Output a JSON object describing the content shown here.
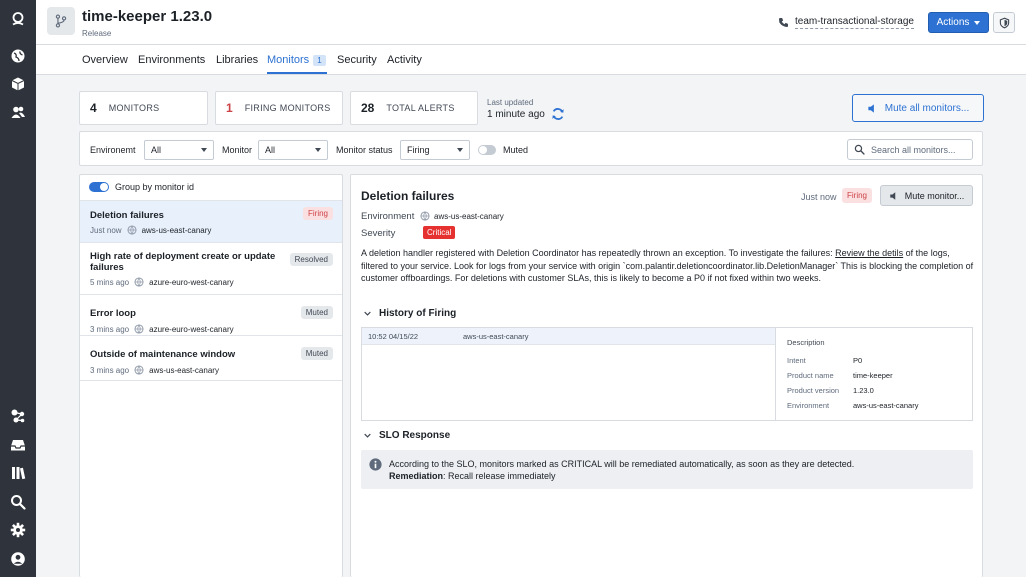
{
  "app": {
    "title": "time-keeper 1.23.0",
    "subtitle": "Release",
    "team": "team-transactional-storage",
    "actions_label": "Actions"
  },
  "tabs": [
    {
      "label": "Overview",
      "active": false
    },
    {
      "label": "Environments",
      "active": false
    },
    {
      "label": "Libraries",
      "active": false
    },
    {
      "label": "Monitors",
      "count": "1",
      "active": true
    },
    {
      "label": "Security",
      "active": false
    },
    {
      "label": "Activity",
      "active": false
    }
  ],
  "stats": {
    "monitors": {
      "value": "4",
      "label": "MONITORS"
    },
    "firing": {
      "value": "1",
      "label": "FIRING MONITORS"
    },
    "alerts": {
      "value": "28",
      "label": "TOTAL ALERTS"
    },
    "updated_label": "Last updated",
    "updated_value": "1 minute ago",
    "mute_all_label": "Mute all monitors..."
  },
  "filters": {
    "environment_label": "Environemt",
    "environment_value": "All",
    "monitor_label": "Monitor",
    "monitor_value": "All",
    "status_label": "Monitor status",
    "status_value": "Firing",
    "muted_label": "Muted",
    "search_placeholder": "Search all monitors..."
  },
  "list": {
    "group_label": "Group by monitor id",
    "items": [
      {
        "title": "Deletion failures",
        "time": "Just now",
        "env": "aws-us-east-canary",
        "status": "Firing"
      },
      {
        "title": "High rate of deployment create or update failures",
        "time": "5 mins ago",
        "env": "azure-euro-west-canary",
        "status": "Resolved"
      },
      {
        "title": "Error loop",
        "time": "3 mins ago",
        "env": "azure-euro-west-canary",
        "status": "Muted"
      },
      {
        "title": "Outside of maintenance window",
        "time": "3 mins ago",
        "env": "aws-us-east-canary",
        "status": "Muted"
      }
    ]
  },
  "detail": {
    "title": "Deletion failures",
    "time": "Just now",
    "status": "Firing",
    "mute_label": "Mute monitor...",
    "environment_label": "Environment",
    "environment_value": "aws-us-east-canary",
    "severity_label": "Severity",
    "severity_value": "Critical",
    "description_before": "A deletion handler registered with Deletion Coordinator has repeatedly thrown an exception. To investigate the failures: ",
    "description_link": "Review the detils",
    "description_after": " of the logs, filtered to your service. Look for logs from your service with origin `com.palantir.deletioncoordinator.lib.DeletionManager` This is blocking the completion of customer offboardings. For deletions with customer SLAs, this is likely to become a P0 if not fixed within two weeks.",
    "history": {
      "title": "History of Firing",
      "rows": [
        {
          "time": "10:52 04/15/22",
          "env": "aws-us-east-canary"
        }
      ],
      "desc_title": "Description",
      "fields": [
        {
          "key": "Intent",
          "value": "P0"
        },
        {
          "key": "Product name",
          "value": "time-keeper"
        },
        {
          "key": "Product version",
          "value": "1.23.0"
        },
        {
          "key": "Environment",
          "value": "aws-us-east-canary"
        }
      ]
    },
    "slo": {
      "title": "SLO Response",
      "text": "According to the SLO, monitors marked as CRITICAL will be remediated automatically, as soon as they are detected.",
      "remediation_label": "Remediation",
      "remediation_value": ": Recall release immediately"
    }
  },
  "colors": {
    "accent": "#2d72d2",
    "rail": "#2f343c",
    "firing": "#cd4246",
    "critical": "#e5312f"
  }
}
